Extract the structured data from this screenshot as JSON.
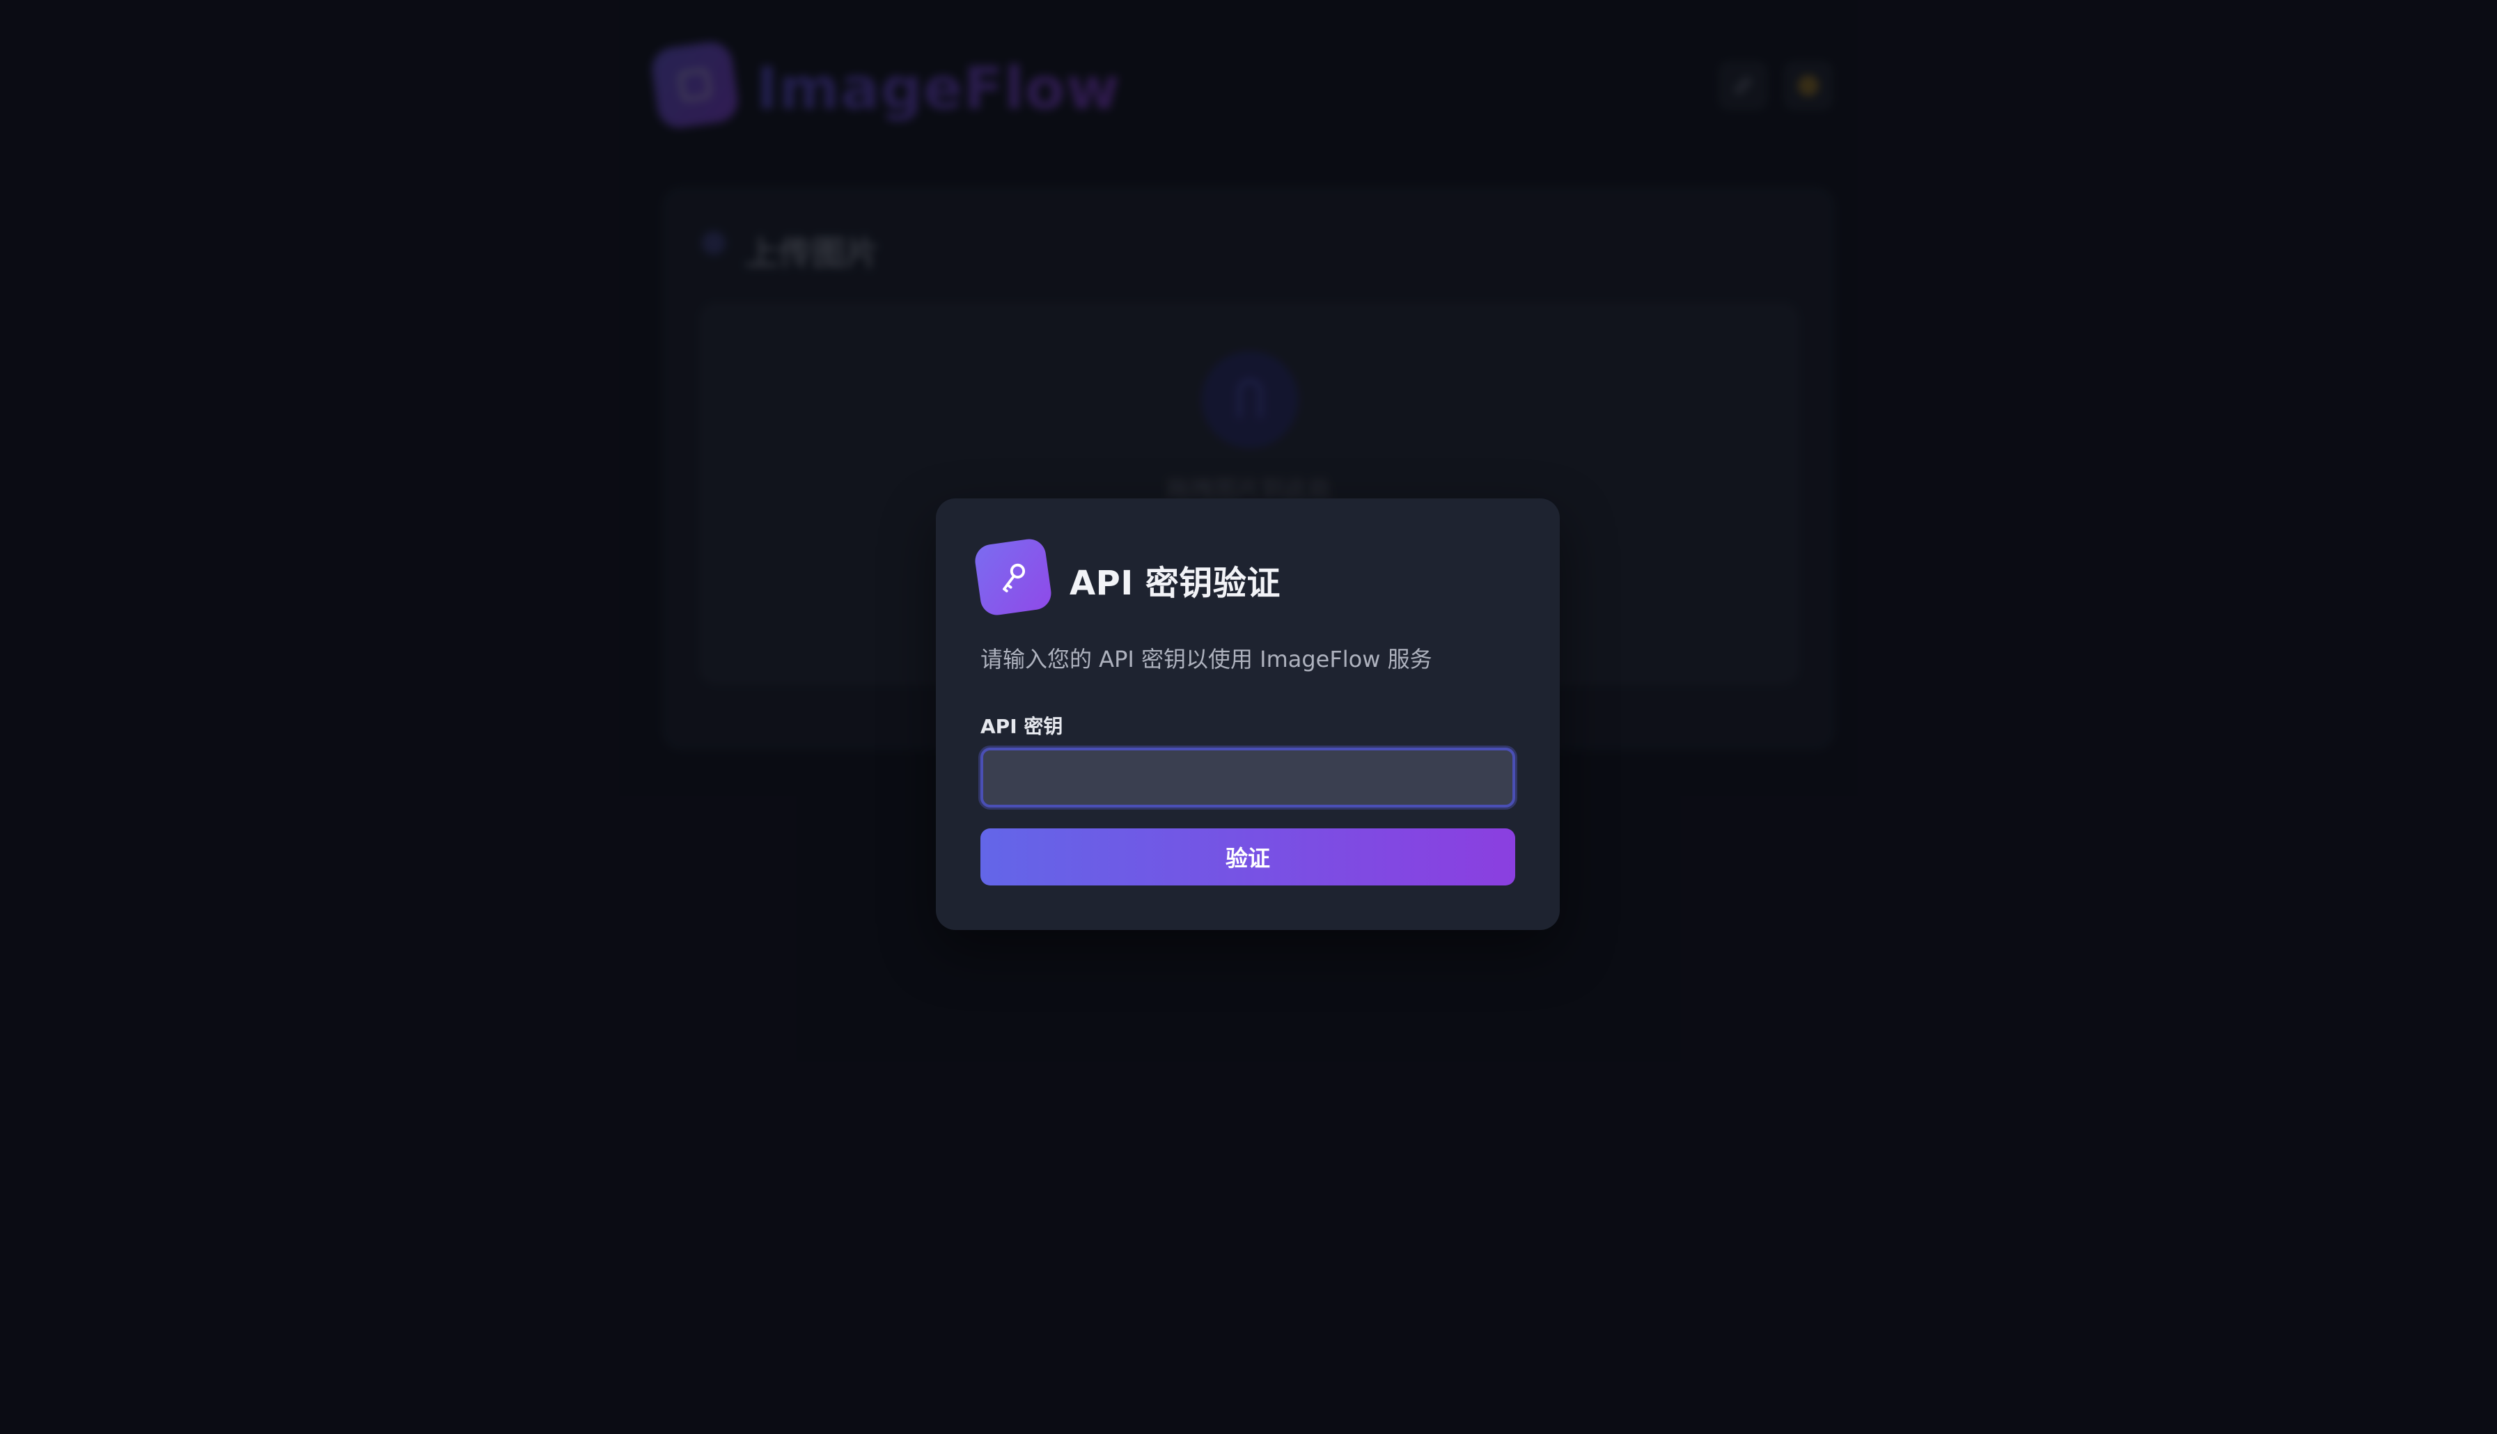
{
  "app": {
    "brand": "ImageFlow"
  },
  "background": {
    "upload_card_title": "上传图片",
    "dropzone_text": "拖拽图片到此处"
  },
  "modal": {
    "title": "API 密钥验证",
    "description": "请输入您的 API 密钥以使用 ImageFlow 服务",
    "field_label": "API 密钥",
    "input_value": "",
    "verify_label": "验证"
  },
  "colors": {
    "background": "#0e1019",
    "modal_background": "#1e2330",
    "accent_start": "#6366e8",
    "accent_end": "#8b3fe0",
    "input_background": "#3a3f50",
    "input_focus_border": "#4a4fb5"
  },
  "icons": {
    "modal_icon": "key-icon",
    "logo_icon": "image-icon",
    "upload_icon": "cloud-upload-icon",
    "theme_toggle_icon": "sun-icon",
    "tool_icon": "brush-icon"
  }
}
